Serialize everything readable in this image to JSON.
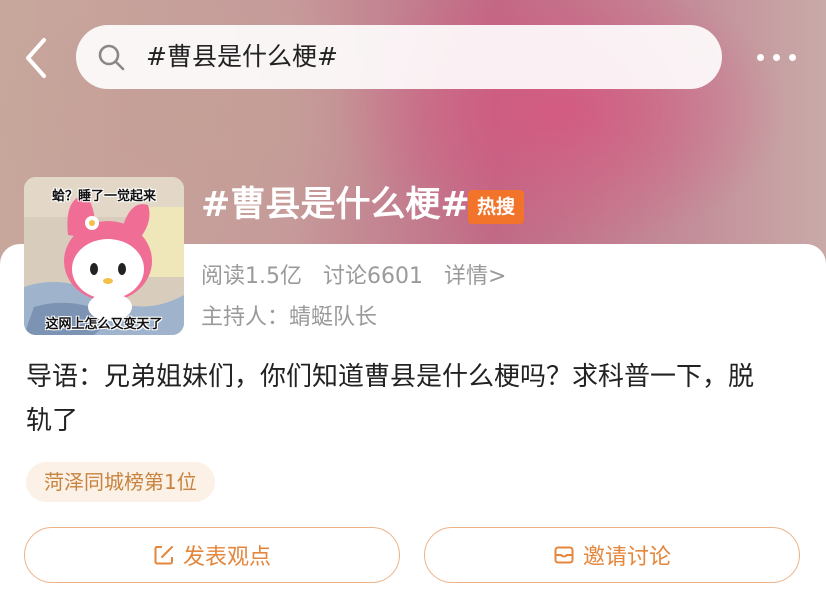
{
  "header": {
    "search_query": "#曹县是什么梗#"
  },
  "topic": {
    "thumbnail_caption_top": "蛤？睡了一觉起来",
    "thumbnail_caption_bottom": "这网上怎么又变天了",
    "title": "#曹县是什么梗#",
    "badge": "热搜",
    "badge_color": "#f2742b",
    "reads": "阅读1.5亿",
    "discussions": "讨论6601",
    "details_link": "详情>",
    "host": "主持人：蜻蜓队长",
    "intro": "导语：兄弟姐妹们，你们知道曹县是什么梗吗？求科普一下，脱轨了",
    "rank_tag": "菏泽同城榜第1位"
  },
  "actions": {
    "post_label": "发表观点",
    "invite_label": "邀请讨论",
    "accent_color": "#e4873c"
  }
}
